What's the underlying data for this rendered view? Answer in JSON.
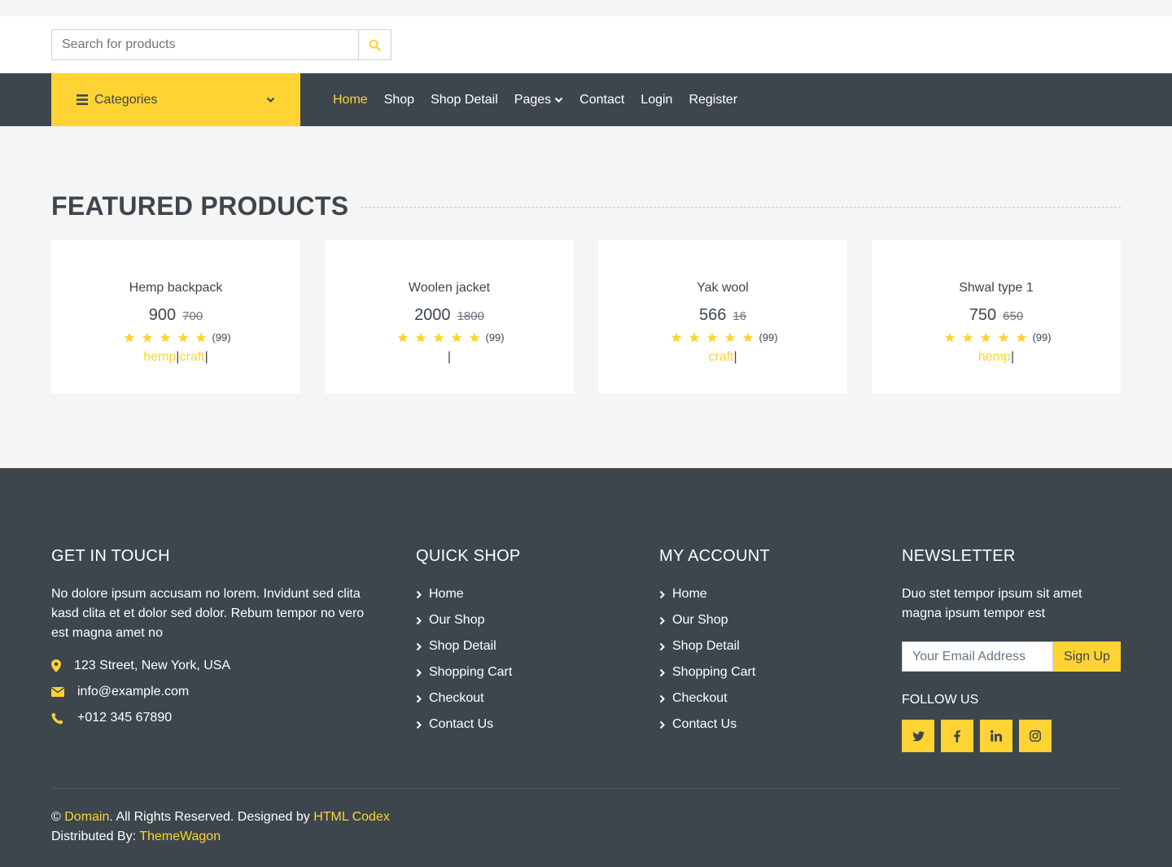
{
  "search": {
    "placeholder": "Search for products"
  },
  "nav": {
    "categories_label": "Categories",
    "links": [
      "Home",
      "Shop",
      "Shop Detail",
      "Pages",
      "Contact",
      "Login",
      "Register"
    ],
    "active": "Home"
  },
  "featured": {
    "title": "FEATURED PRODUCTS",
    "products": [
      {
        "name": "Hemp backpack",
        "price": "900",
        "old_price": "700",
        "stars": 5,
        "reviews": "(99)",
        "tags": [
          "hemp",
          "craft"
        ]
      },
      {
        "name": "Woolen jacket",
        "price": "2000",
        "old_price": "1800",
        "stars": 5,
        "reviews": "(99)",
        "tags": []
      },
      {
        "name": "Yak wool",
        "price": "566",
        "old_price": "16",
        "stars": 5,
        "reviews": "(99)",
        "tags": [
          "craft"
        ]
      },
      {
        "name": "Shwal type 1",
        "price": "750",
        "old_price": "650",
        "stars": 5,
        "reviews": "(99)",
        "tags": [
          "hemp"
        ]
      }
    ]
  },
  "footer": {
    "get_in_touch": {
      "title": "GET IN TOUCH",
      "text": "No dolore ipsum accusam no lorem. Invidunt sed clita kasd clita et et dolor sed dolor. Rebum tempor no vero est magna amet no",
      "address": "123 Street, New York, USA",
      "email": "info@example.com",
      "phone": "+012 345 67890"
    },
    "quick_shop": {
      "title": "QUICK SHOP",
      "links": [
        "Home",
        "Our Shop",
        "Shop Detail",
        "Shopping Cart",
        "Checkout",
        "Contact Us"
      ]
    },
    "my_account": {
      "title": "MY ACCOUNT",
      "links": [
        "Home",
        "Our Shop",
        "Shop Detail",
        "Shopping Cart",
        "Checkout",
        "Contact Us"
      ]
    },
    "newsletter": {
      "title": "NEWSLETTER",
      "text": "Duo stet tempor ipsum sit amet magna ipsum tempor est",
      "email_placeholder": "Your Email Address",
      "button": "Sign Up",
      "follow_label": "FOLLOW US",
      "socials": [
        "twitter-icon",
        "facebook-icon",
        "linkedin-icon",
        "instagram-icon"
      ]
    },
    "copyright": {
      "symbol": "©",
      "domain": "Domain",
      "rights": ". All Rights Reserved. Designed by",
      "designer": "HTML Codex",
      "distributed_label": "Distributed By:",
      "distributor": "ThemeWagon"
    }
  },
  "colors": {
    "accent": "#ffd333",
    "dark": "#3d464d",
    "light": "#f5f5f5"
  }
}
